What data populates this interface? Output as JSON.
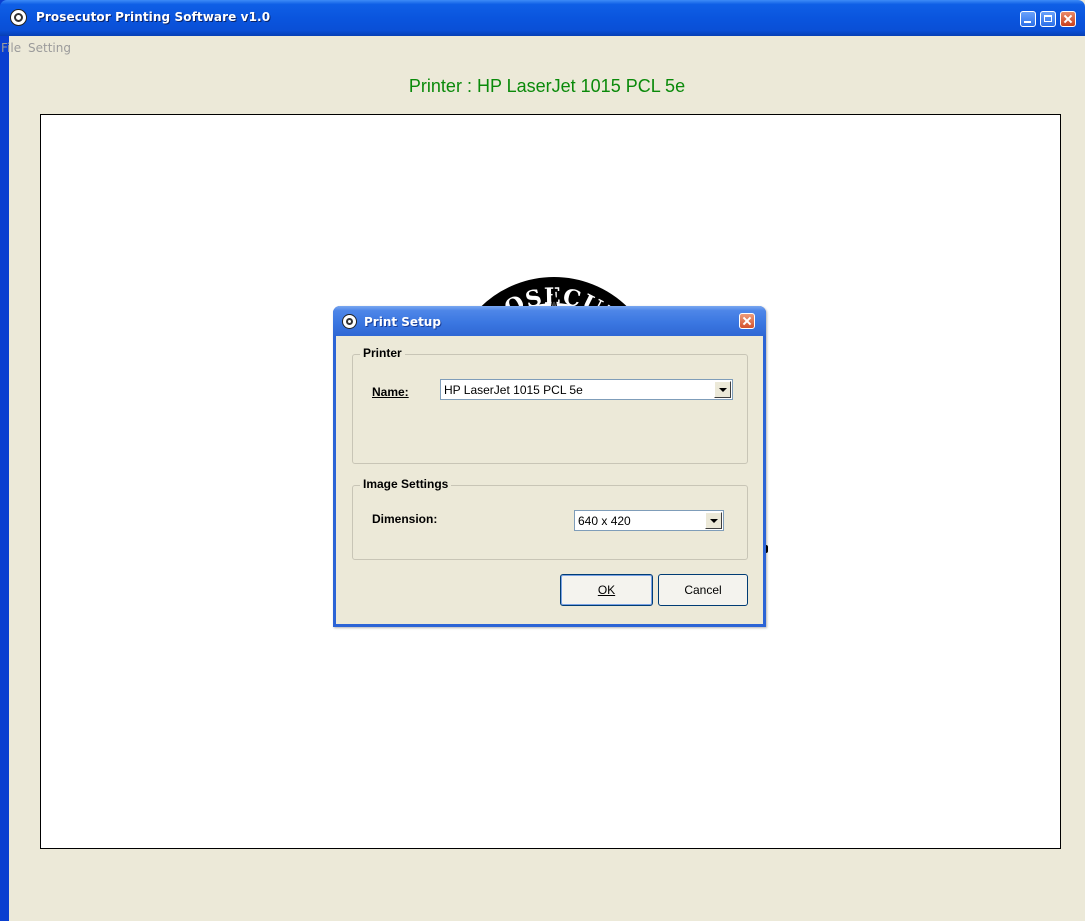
{
  "window": {
    "title": "Prosecutor Printing Software v1.0"
  },
  "menu": {
    "items": [
      "File",
      "Setting"
    ]
  },
  "main": {
    "printer_heading": "Printer : HP LaserJet 1015 PCL 5e",
    "seal_text": "PROSECUTO"
  },
  "dialog": {
    "title": "Print Setup",
    "printer_group": {
      "legend": "Printer",
      "name_label": "Name:",
      "name_value": "HP LaserJet 1015 PCL 5e"
    },
    "image_group": {
      "legend": "Image Settings",
      "dimension_label": "Dimension:",
      "dimension_value": "640 x 420"
    },
    "ok_label": "OK",
    "cancel_label": "Cancel"
  },
  "colors": {
    "titlebar": "#0a55de",
    "heading_green": "#0a8a0a",
    "dialog_border": "#2c64d6",
    "window_bg": "#ece9d8"
  },
  "icons": [
    "app-icon",
    "minimize-icon",
    "maximize-icon",
    "close-icon",
    "dropdown-arrow-icon"
  ]
}
